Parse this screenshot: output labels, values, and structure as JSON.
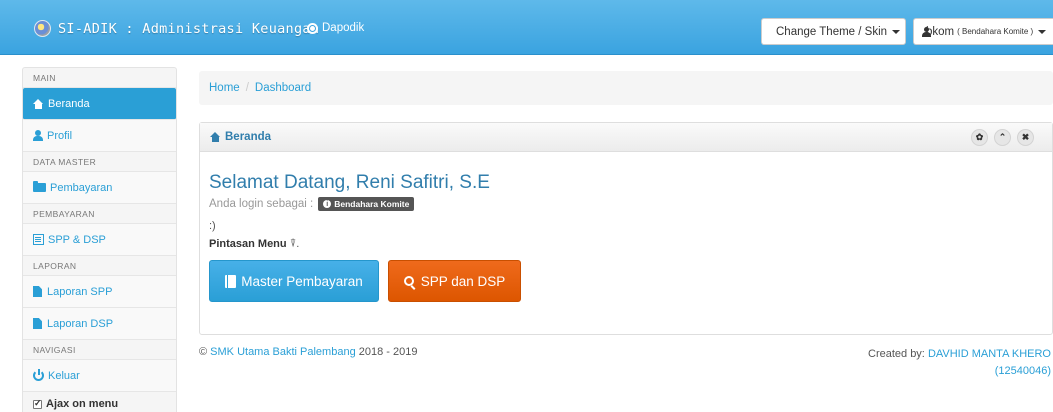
{
  "navbar": {
    "brand": "SI-ADIK : Administrasi Keuangan",
    "dapodik_link": "Dapodik",
    "theme_button": "Change Theme / Skin",
    "user_name": "bkom",
    "user_role": "( Bendahara Komite )"
  },
  "sidebar": {
    "sections": {
      "main": "MAIN",
      "data_master": "DATA MASTER",
      "pembayaran": "PEMBAYARAN",
      "laporan": "LAPORAN",
      "navigasi": "NAVIGASI"
    },
    "items": {
      "beranda": "Beranda",
      "profil": "Profil",
      "pembayaran": "Pembayaran",
      "spp_dsp": "SPP & DSP",
      "laporan_spp": "Laporan SPP",
      "laporan_dsp": "Laporan DSP",
      "keluar": "Keluar"
    },
    "ajax_label": "Ajax on menu"
  },
  "breadcrumb": {
    "home": "Home",
    "separator": "/",
    "current": "Dashboard"
  },
  "box": {
    "title": "Beranda",
    "controls": {
      "settings": "✿",
      "collapse": "⌃",
      "close": "✖"
    },
    "welcome": "Selamat Datang, Reni Safitri, S.E",
    "login_as": "Anda login sebagai :",
    "role_badge": "Bendahara Komite",
    "smile": ":)",
    "shortcut_label": "Pintasan Menu",
    "shortcut_symbol": "⍒.",
    "btn_master": "Master Pembayaran",
    "btn_spp": "SPP dan DSP"
  },
  "footer": {
    "copyright_symbol": "©",
    "school": "SMK Utama Bakti Palembang",
    "years": "2018 - 2019",
    "created_by": "Created by:",
    "author": "DAVHID MANTA KHERO",
    "author_id": "(12540046)"
  },
  "colors": {
    "navbar": "#3aa3e0",
    "link": "#2a9fd6",
    "title": "#317eac",
    "orange": "#dd5600"
  }
}
